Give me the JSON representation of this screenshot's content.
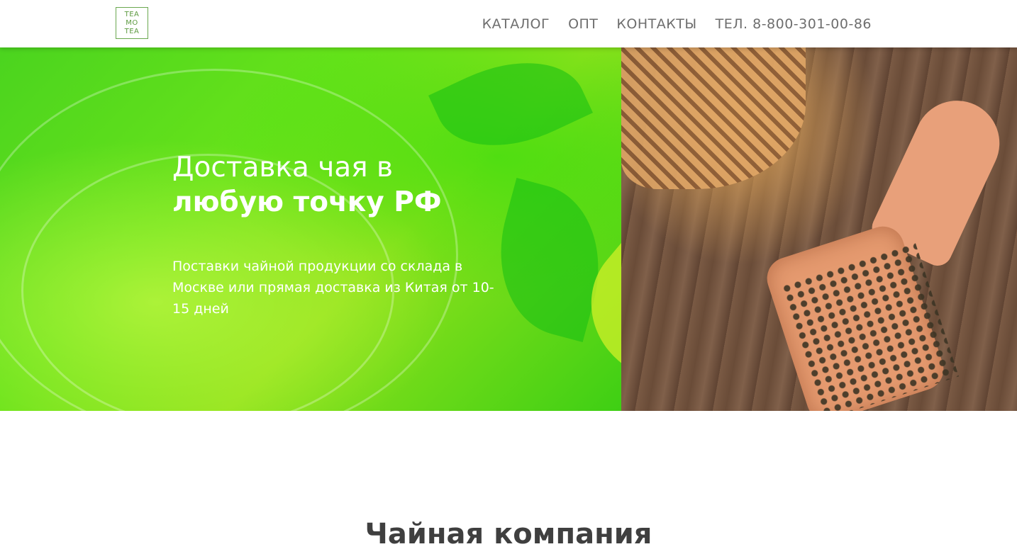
{
  "header": {
    "logo": {
      "lines": [
        "TEA",
        "MO",
        "TEA"
      ]
    },
    "nav": [
      "КАТАЛОГ",
      "ОПТ",
      "КОНТАКТЫ",
      "ТЕЛ. 8-800-301-00-86"
    ]
  },
  "hero": {
    "title_line1": "Доставка чая в",
    "title_line2": "любую точку РФ",
    "description": "Поставки чайной продукции со склада в Москве или прямая доставка из Китая от 10-15 дней"
  },
  "section": {
    "title": "Чайная компания"
  },
  "colors": {
    "accent_green": "#4bd41f",
    "logo_green": "#5c9a3f",
    "nav_text": "#6e6e6e"
  }
}
